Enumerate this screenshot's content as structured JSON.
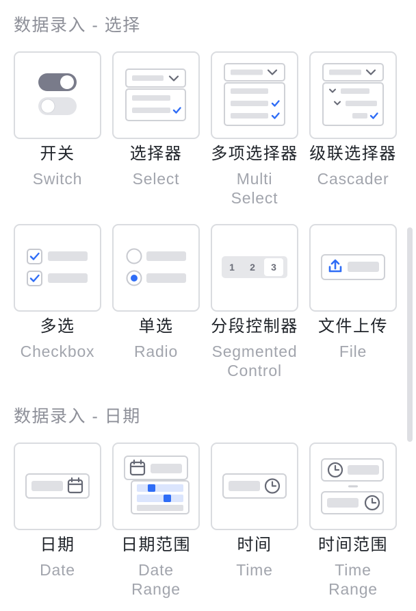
{
  "colors": {
    "accent": "#2f6df6",
    "accent_light": "#dbe5fd",
    "toggle_on": "#797b8a",
    "section_title": "#8d8f98",
    "label_primary": "#1f2329",
    "label_secondary": "#a2a5ad",
    "card_border": "#dadce0",
    "box_stroke": "#cfd1d6",
    "bar": "#dfe0e4",
    "icon": "#666975",
    "scrollbar": "#dedfe3"
  },
  "sections": [
    {
      "title": "数据录入 - 选择",
      "items": [
        {
          "label": "开关",
          "sublabel": "Switch",
          "icon": "switch-icon"
        },
        {
          "label": "选择器",
          "sublabel": "Select",
          "icon": "select-icon"
        },
        {
          "label": "多项选择器",
          "sublabel": "Multi Select",
          "icon": "multi-select-icon"
        },
        {
          "label": "级联选择器",
          "sublabel": "Cascader",
          "icon": "cascader-icon"
        },
        {
          "label": "多选",
          "sublabel": "Checkbox",
          "icon": "checkbox-icon"
        },
        {
          "label": "单选",
          "sublabel": "Radio",
          "icon": "radio-icon"
        },
        {
          "label": "分段控制器",
          "sublabel": "Segmented Control",
          "icon": "segmented-control-icon",
          "segments": [
            "1",
            "2",
            "3"
          ],
          "selected_segment_index": 2
        },
        {
          "label": "文件上传",
          "sublabel": "File",
          "icon": "upload-icon"
        }
      ]
    },
    {
      "title": "数据录入 - 日期",
      "items": [
        {
          "label": "日期",
          "sublabel": "Date",
          "icon": "calendar-icon"
        },
        {
          "label": "日期范围",
          "sublabel": "Date Range",
          "icon": "date-range-icon"
        },
        {
          "label": "时间",
          "sublabel": "Time",
          "icon": "clock-icon"
        },
        {
          "label": "时间范围",
          "sublabel": "Time Range",
          "icon": "time-range-icon"
        }
      ]
    }
  ]
}
